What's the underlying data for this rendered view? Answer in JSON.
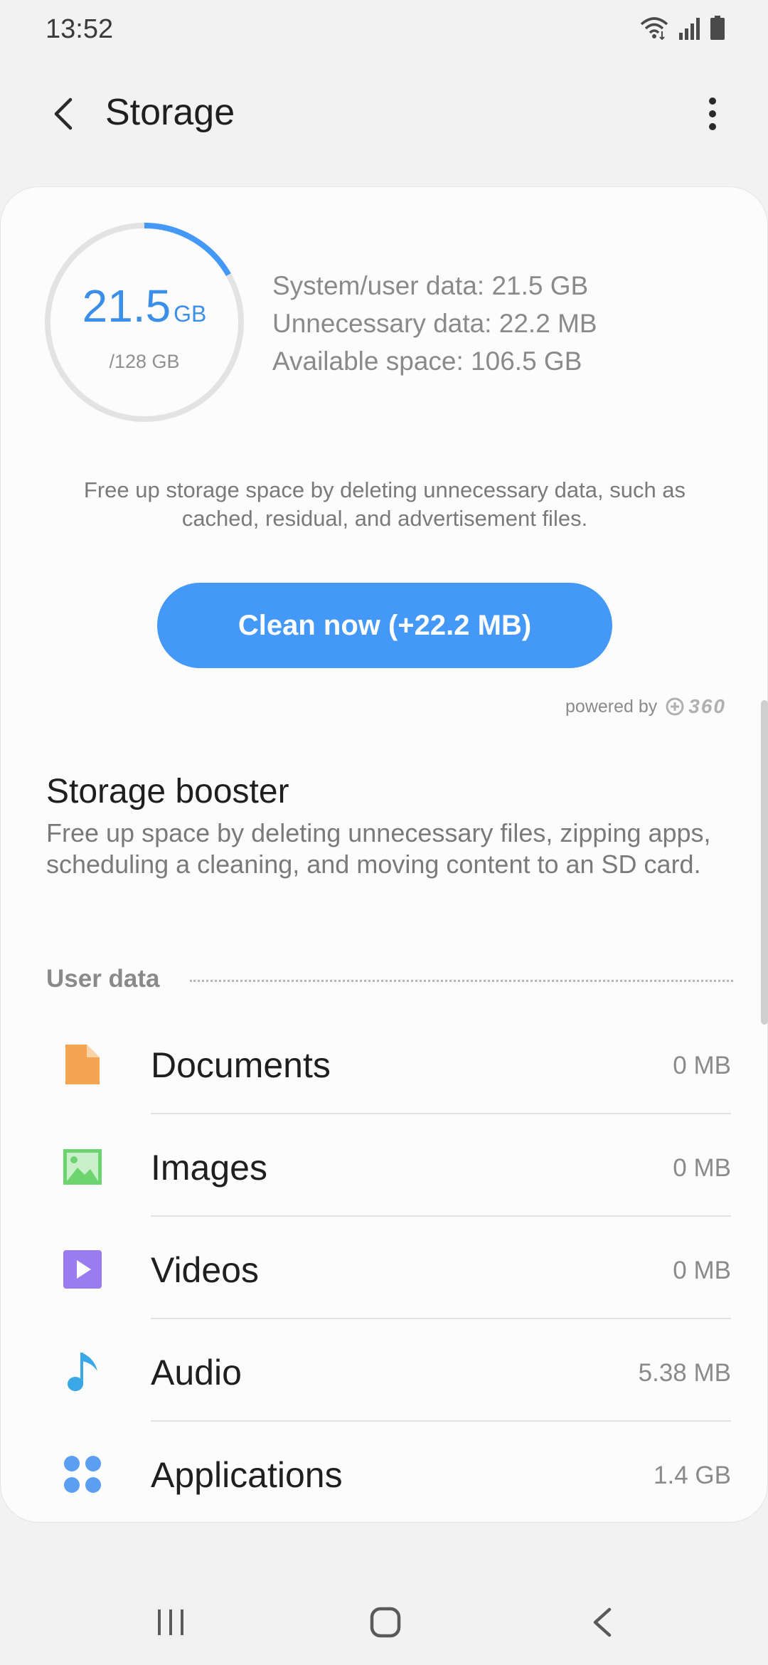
{
  "status_bar": {
    "time": "13:52"
  },
  "header": {
    "title": "Storage"
  },
  "usage": {
    "used_number": "21.5",
    "used_unit": "GB",
    "total_label": "/128 GB",
    "used_fraction": 0.168,
    "stats": [
      "System/user data: 21.5 GB",
      "Unnecessary data: 22.2 MB",
      "Available space: 106.5 GB"
    ]
  },
  "cleanup": {
    "description": "Free up storage space by deleting unnecessary data, such as cached, residual, and advertisement files.",
    "button_label": "Clean now (+22.2 MB)",
    "powered_by": "powered by",
    "brand": "360"
  },
  "booster": {
    "title": "Storage booster",
    "description": "Free up space by deleting unnecessary files, zipping apps, scheduling a cleaning, and moving content to an SD card."
  },
  "user_data": {
    "label": "User data",
    "items": [
      {
        "label": "Documents",
        "size": "0 MB",
        "icon": "document-icon",
        "color": "#f5a452"
      },
      {
        "label": "Images",
        "size": "0 MB",
        "icon": "image-icon",
        "color": "#6dd46e"
      },
      {
        "label": "Videos",
        "size": "0 MB",
        "icon": "video-icon",
        "color": "#9b7cf0"
      },
      {
        "label": "Audio",
        "size": "5.38 MB",
        "icon": "music-note-icon",
        "color": "#3aa8e6"
      },
      {
        "label": "Applications",
        "size": "1.4 GB",
        "icon": "apps-grid-icon",
        "color": "#5b9ff0"
      }
    ]
  },
  "colors": {
    "accent": "#4499f8",
    "ring_track": "#e3e3e3",
    "ring_fill": "#4499f8"
  }
}
